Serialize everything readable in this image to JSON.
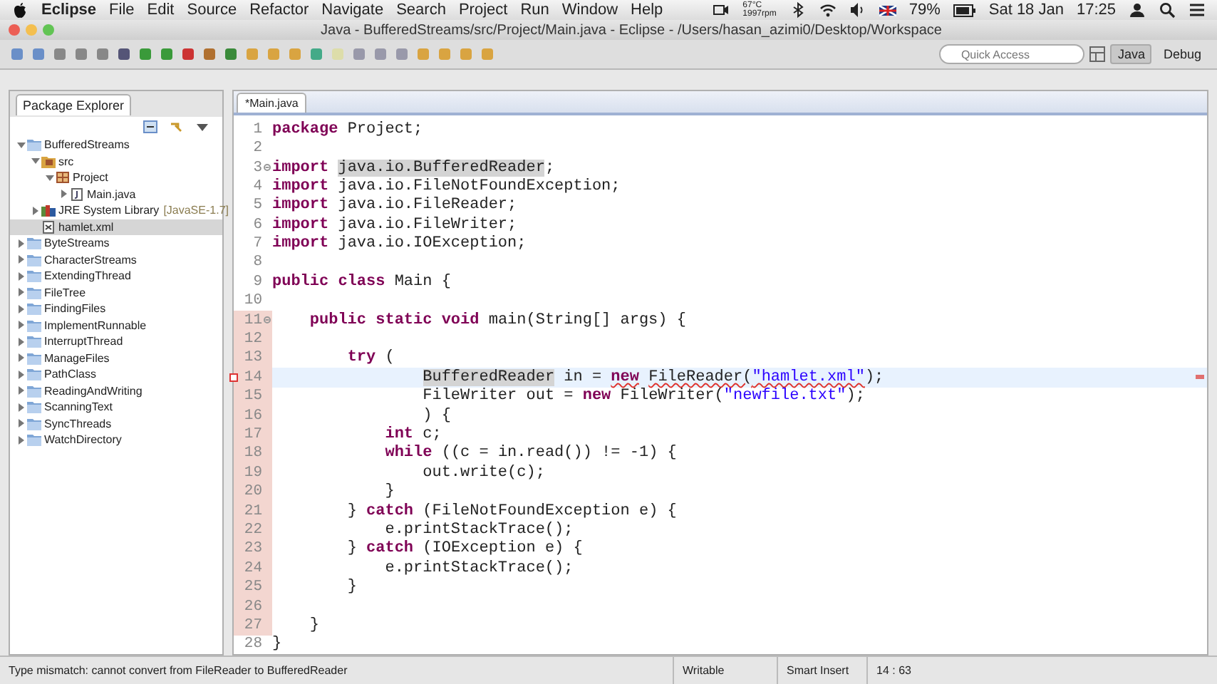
{
  "menu_bar": {
    "app": "Eclipse",
    "items": [
      "File",
      "Edit",
      "Source",
      "Refactor",
      "Navigate",
      "Search",
      "Project",
      "Run",
      "Window",
      "Help"
    ],
    "temperature": "67°C",
    "fan": "1997rpm",
    "battery": "79%",
    "date": "Sat 18 Jan",
    "time": "17:25"
  },
  "window": {
    "title": "Java - BufferedStreams/src/Project/Main.java - Eclipse - /Users/hasan_azimi0/Desktop/Workspace"
  },
  "toolbar": {
    "search": {
      "placeholder": "Quick Access"
    },
    "perspectives": [
      {
        "label": "Java",
        "selected": true
      },
      {
        "label": "Debug",
        "selected": false
      }
    ]
  },
  "package_explorer": {
    "title": "Package Explorer",
    "tree": [
      {
        "label": "BufferedStreams",
        "kind": "project",
        "expanded": true,
        "selected": false,
        "children": [
          {
            "label": "src",
            "kind": "source",
            "expanded": true,
            "selected": false,
            "children": [
              {
                "label": "Project",
                "kind": "package",
                "expanded": true,
                "selected": false,
                "children": [
                  {
                    "label": "Main.java",
                    "kind": "java",
                    "expanded": false,
                    "selected": false
                  }
                ]
              }
            ]
          },
          {
            "label": "JRE System Library",
            "decoration": "[JavaSE-1.7]",
            "kind": "library",
            "expanded": false,
            "selected": false
          },
          {
            "label": "hamlet.xml",
            "kind": "xml",
            "selected": true
          }
        ]
      },
      {
        "label": "ByteStreams",
        "kind": "project",
        "expanded": false,
        "selected": false
      },
      {
        "label": "CharacterStreams",
        "kind": "project",
        "expanded": false,
        "selected": false
      },
      {
        "label": "ExtendingThread",
        "kind": "project",
        "expanded": false,
        "selected": false
      },
      {
        "label": "FileTree",
        "kind": "project",
        "expanded": false,
        "selected": false
      },
      {
        "label": "FindingFiles",
        "kind": "project",
        "expanded": false,
        "selected": false
      },
      {
        "label": "ImplementRunnable",
        "kind": "project",
        "expanded": false,
        "selected": false
      },
      {
        "label": "InterruptThread",
        "kind": "project",
        "expanded": false,
        "selected": false
      },
      {
        "label": "ManageFiles",
        "kind": "project",
        "expanded": false,
        "selected": false
      },
      {
        "label": "PathClass",
        "kind": "project",
        "expanded": false,
        "selected": false
      },
      {
        "label": "ReadingAndWriting",
        "kind": "project",
        "expanded": false,
        "selected": false
      },
      {
        "label": "ScanningText",
        "kind": "project",
        "expanded": false,
        "selected": false
      },
      {
        "label": "SyncThreads",
        "kind": "project",
        "expanded": false,
        "selected": false
      },
      {
        "label": "WatchDirectory",
        "kind": "project",
        "expanded": false,
        "selected": false
      }
    ]
  },
  "editor": {
    "tab": "*Main.java",
    "lines": [
      {
        "number": "1",
        "tokens": [
          {
            "kind": "keyword",
            "text": "package"
          },
          {
            "kind": "plain",
            "text": " Project;"
          }
        ]
      },
      {
        "number": "2"
      },
      {
        "number": "3",
        "folding": true,
        "tokens": [
          {
            "kind": "keyword",
            "text": "import"
          },
          {
            "kind": "occurrence",
            "text": " java.io.BufferedReader"
          },
          {
            "kind": "plain",
            "text": ";"
          }
        ]
      },
      {
        "number": "4",
        "tokens": [
          {
            "kind": "keyword",
            "text": "import"
          },
          {
            "kind": "plain",
            "text": " java.io.FileNotFoundException;"
          }
        ]
      },
      {
        "number": "5",
        "tokens": [
          {
            "kind": "keyword",
            "text": "import"
          },
          {
            "kind": "plain",
            "text": " java.io.FileReader;"
          }
        ]
      },
      {
        "number": "6",
        "tokens": [
          {
            "kind": "keyword",
            "text": "import"
          },
          {
            "kind": "plain",
            "text": " java.io.FileWriter;"
          }
        ]
      },
      {
        "number": "7",
        "tokens": [
          {
            "kind": "keyword",
            "text": "import"
          },
          {
            "kind": "plain",
            "text": " java.io.IOException;"
          }
        ]
      },
      {
        "number": "8"
      },
      {
        "number": "9",
        "tokens": [
          {
            "kind": "keyword",
            "text": "public class"
          },
          {
            "kind": "plain",
            "text": " Main {"
          }
        ]
      },
      {
        "number": "10"
      },
      {
        "number": "11",
        "folding": true,
        "tokens": [
          {
            "kind": "keyword",
            "text": "    public static void"
          },
          {
            "kind": "plain",
            "text": " main(String[] args) {"
          }
        ]
      },
      {
        "number": "12"
      },
      {
        "number": "13",
        "tokens": [
          {
            "kind": "keyword",
            "text": "        try"
          },
          {
            "kind": "plain",
            "text": " ("
          }
        ]
      },
      {
        "number": "14",
        "current": true,
        "error": true,
        "tokens": [
          {
            "kind": "occurrence",
            "text": "                BufferedReader"
          },
          {
            "kind": "plain",
            "text": " in = "
          },
          {
            "kind": "error_keyword",
            "text": "new"
          },
          {
            "kind": "error",
            "text": " FileReader("
          },
          {
            "kind": "error_string",
            "text": "\"hamlet.xml\""
          },
          {
            "kind": "plain",
            "text": ");"
          }
        ]
      },
      {
        "number": "15",
        "tokens": [
          {
            "kind": "plain",
            "text": "                FileWriter out = "
          },
          {
            "kind": "keyword",
            "text": "new"
          },
          {
            "kind": "plain",
            "text": " FileWriter("
          },
          {
            "kind": "string",
            "text": "\"newfile.txt\""
          },
          {
            "kind": "plain",
            "text": ");"
          }
        ]
      },
      {
        "number": "16",
        "tokens": [
          {
            "kind": "plain",
            "text": "                ) {"
          }
        ]
      },
      {
        "number": "17",
        "tokens": [
          {
            "kind": "keyword",
            "text": "            int"
          },
          {
            "kind": "plain",
            "text": " c;"
          }
        ]
      },
      {
        "number": "18",
        "tokens": [
          {
            "kind": "keyword",
            "text": "            while"
          },
          {
            "kind": "plain",
            "text": " ((c = in.read()) != -1) {"
          }
        ]
      },
      {
        "number": "19",
        "tokens": [
          {
            "kind": "plain",
            "text": "                out.write(c);"
          }
        ]
      },
      {
        "number": "20",
        "tokens": [
          {
            "kind": "plain",
            "text": "            }"
          }
        ]
      },
      {
        "number": "21",
        "tokens": [
          {
            "kind": "plain",
            "text": "        } "
          },
          {
            "kind": "keyword",
            "text": "catch"
          },
          {
            "kind": "plain",
            "text": " (FileNotFoundException e) {"
          }
        ]
      },
      {
        "number": "22",
        "tokens": [
          {
            "kind": "plain",
            "text": "            e.printStackTrace();"
          }
        ]
      },
      {
        "number": "23",
        "tokens": [
          {
            "kind": "plain",
            "text": "        } "
          },
          {
            "kind": "keyword",
            "text": "catch"
          },
          {
            "kind": "plain",
            "text": " (IOException e) {"
          }
        ]
      },
      {
        "number": "24",
        "tokens": [
          {
            "kind": "plain",
            "text": "            e.printStackTrace();"
          }
        ]
      },
      {
        "number": "25",
        "tokens": [
          {
            "kind": "plain",
            "text": "        }"
          }
        ]
      },
      {
        "number": "26"
      },
      {
        "number": "27",
        "tokens": [
          {
            "kind": "plain",
            "text": "    }"
          }
        ]
      },
      {
        "number": "28",
        "tokens": [
          {
            "kind": "plain",
            "text": "}"
          }
        ]
      }
    ]
  },
  "status_bar": {
    "message": "Type mismatch: cannot convert from FileReader to BufferedReader",
    "mode": "Writable",
    "insert": "Smart Insert",
    "position": "14 : 63"
  }
}
